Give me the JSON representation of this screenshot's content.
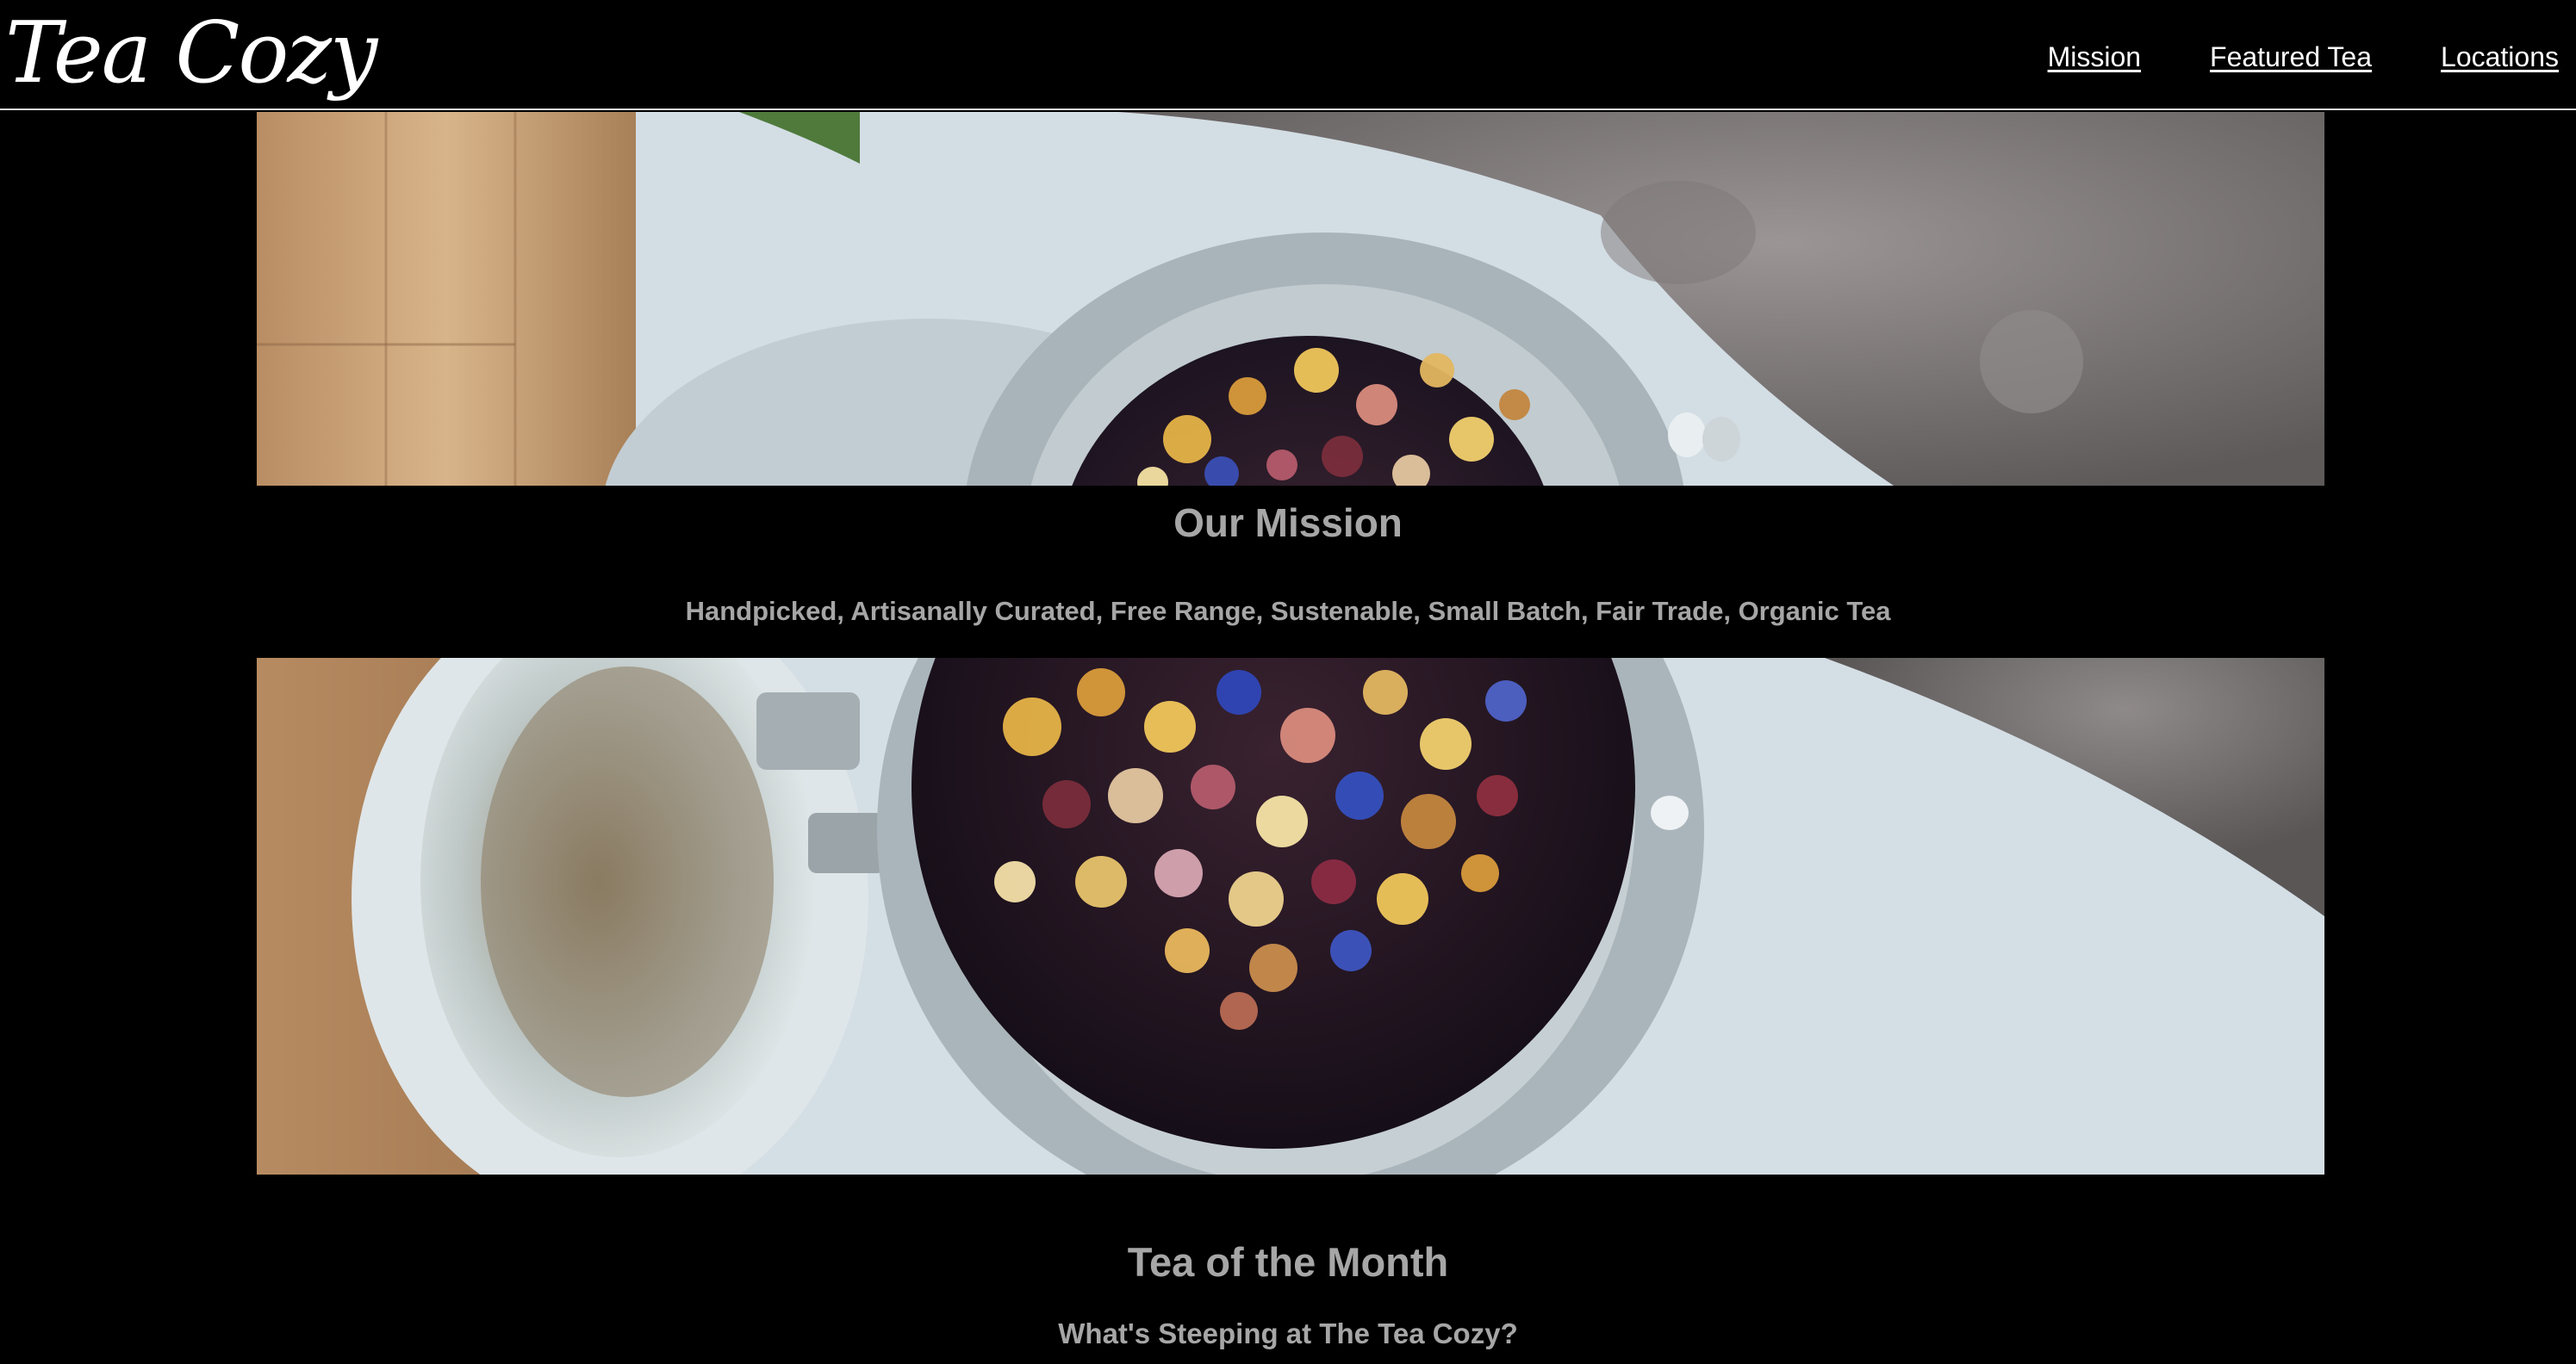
{
  "header": {
    "logo": "Tea Cozy",
    "nav": [
      {
        "label": "Mission"
      },
      {
        "label": "Featured Tea"
      },
      {
        "label": "Locations"
      }
    ]
  },
  "mission": {
    "heading": "Our Mission",
    "subheading": "Handpicked, Artisanally Curated, Free Range, Sustenable, Small Batch, Fair Trade, Organic Tea"
  },
  "tea_of_month": {
    "heading": "Tea of the Month",
    "subheading": "What's Steeping at The Tea Cozy?"
  },
  "colors": {
    "background": "#000000",
    "nav_link": "#ffffff",
    "heading_text": "#a6a6a6"
  }
}
